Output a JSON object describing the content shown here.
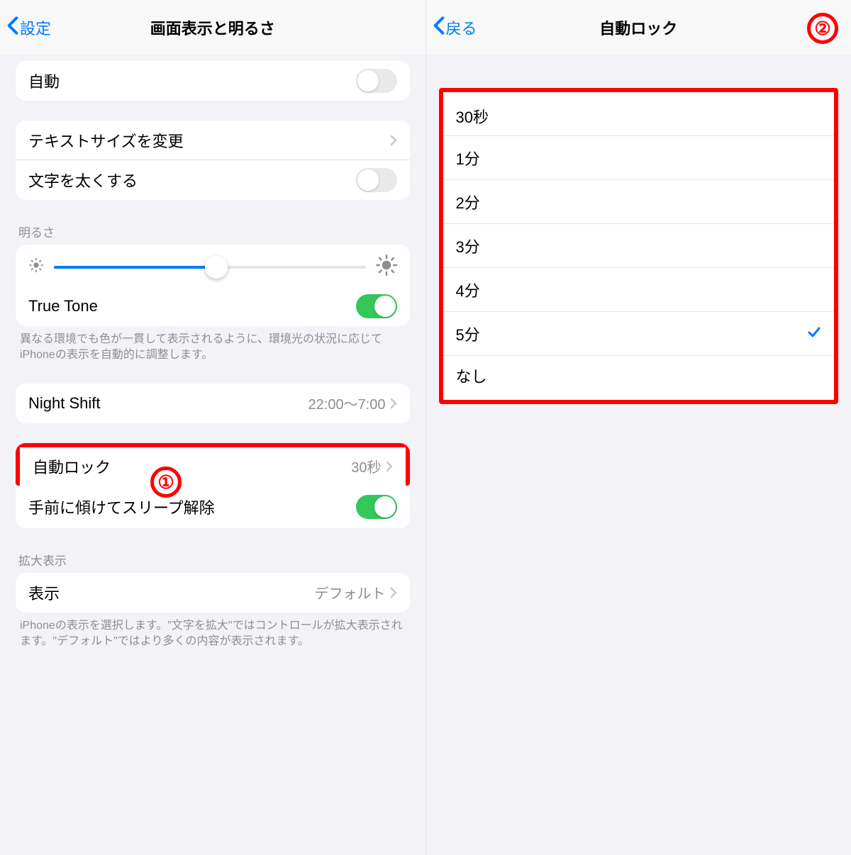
{
  "left": {
    "nav": {
      "back": "設定",
      "title": "画面表示と明るさ"
    },
    "auto_label": "自動",
    "text_size_label": "テキストサイズを変更",
    "bold_text_label": "文字を太くする",
    "brightness_header": "明るさ",
    "true_tone_label": "True Tone",
    "true_tone_footer": "異なる環境でも色が一貫して表示されるように、環境光の状況に応じてiPhoneの表示を自動的に調整します。",
    "night_shift_label": "Night Shift",
    "night_shift_value": "22:00～7:00",
    "auto_lock_label": "自動ロック",
    "auto_lock_value": "30秒",
    "raise_to_wake_label": "手前に傾けてスリープ解除",
    "zoom_header": "拡大表示",
    "zoom_label": "表示",
    "zoom_value": "デフォルト",
    "zoom_footer": "iPhoneの表示を選択します。\"文字を拡大\"ではコントロールが拡大表示されます。\"デフォルト\"ではより多くの内容が表示されます。"
  },
  "right": {
    "nav": {
      "back": "戻る",
      "title": "自動ロック"
    },
    "options": [
      {
        "label": "30秒",
        "selected": false
      },
      {
        "label": "1分",
        "selected": false
      },
      {
        "label": "2分",
        "selected": false
      },
      {
        "label": "3分",
        "selected": false
      },
      {
        "label": "4分",
        "selected": false
      },
      {
        "label": "5分",
        "selected": true
      },
      {
        "label": "なし",
        "selected": false
      }
    ]
  },
  "callouts": {
    "one": "①",
    "two": "②"
  }
}
